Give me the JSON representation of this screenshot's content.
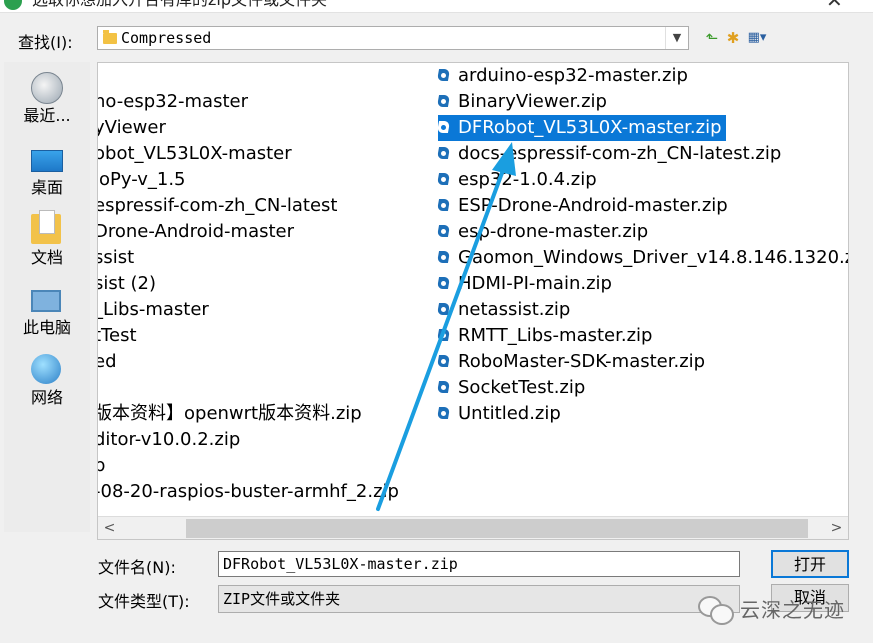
{
  "window": {
    "title": "选取你想加入开合有库的zip文件或文件夹"
  },
  "lookin": {
    "label": "查找(I):",
    "value": "Compressed"
  },
  "places": [
    {
      "label": "最近...",
      "icon": "recent-places-icon"
    },
    {
      "label": "桌面",
      "icon": "desktop-icon"
    },
    {
      "label": "文档",
      "icon": "documents-icon"
    },
    {
      "label": "此电脑",
      "icon": "this-pc-icon"
    },
    {
      "label": "网络",
      "icon": "network-icon"
    }
  ],
  "files_col1": [
    "no-esp32-master",
    "yViewer",
    "obot_VL53L0X-master",
    "loPy-v_1.5",
    "espressif-com-zh_CN-latest",
    "Drone-Android-master",
    "ssist",
    "sist (2)",
    "_Libs-master",
    "tTest",
    "ed",
    "",
    "版本资料】openwrt版本资料.zip",
    "ditor-v10.0.2.zip",
    "p",
    "-08-20-raspios-buster-armhf_2.zip"
  ],
  "files_col2": [
    "arduino-esp32-master.zip",
    "BinaryViewer.zip",
    "DFRobot_VL53L0X-master.zip",
    "docs-espressif-com-zh_CN-latest.zip",
    "esp32-1.0.4.zip",
    "ESP-Drone-Android-master.zip",
    "esp-drone-master.zip",
    "Gaomon_Windows_Driver_v14.8.146.1320.zip",
    "HDMI-PI-main.zip",
    "netassist.zip",
    "RMTT_Libs-master.zip",
    "RoboMaster-SDK-master.zip",
    "SocketTest.zip",
    "Untitled.zip"
  ],
  "selected_file": "DFRobot_VL53L0X-master.zip",
  "filename": {
    "label": "文件名(N):",
    "value": "DFRobot_VL53L0X-master.zip"
  },
  "filetype": {
    "label": "文件类型(T):",
    "value": "ZIP文件或文件夹"
  },
  "buttons": {
    "open": "打开",
    "cancel": "取消"
  },
  "watermark": {
    "text": "云深之无迹"
  },
  "colors": {
    "selection": "#0a78d7",
    "arrow": "#1a9ee0",
    "zip_icon": "#1d6fb8"
  }
}
